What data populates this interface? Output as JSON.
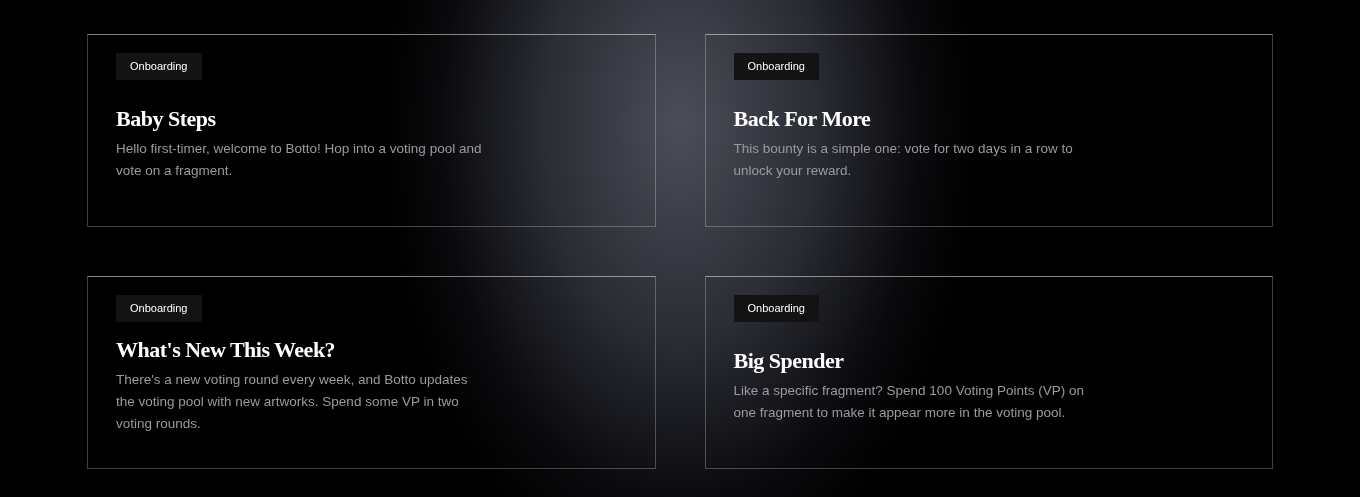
{
  "bounties": [
    {
      "tag": "Onboarding",
      "title": "Baby Steps",
      "description": "Hello first-timer, welcome to Botto! Hop into a voting pool and vote on a fragment."
    },
    {
      "tag": "Onboarding",
      "title": "Back For More",
      "description": "This bounty is a simple one: vote for two days in a row to unlock your reward."
    },
    {
      "tag": "Onboarding",
      "title": "What's New This Week?",
      "description": "There's a new voting round every week, and Botto updates the voting pool with new artworks. Spend some VP in two voting rounds."
    },
    {
      "tag": "Onboarding",
      "title": "Big Spender",
      "description": "Like a specific fragment? Spend 100 Voting Points (VP) on one fragment to make it appear more in the voting pool."
    }
  ]
}
